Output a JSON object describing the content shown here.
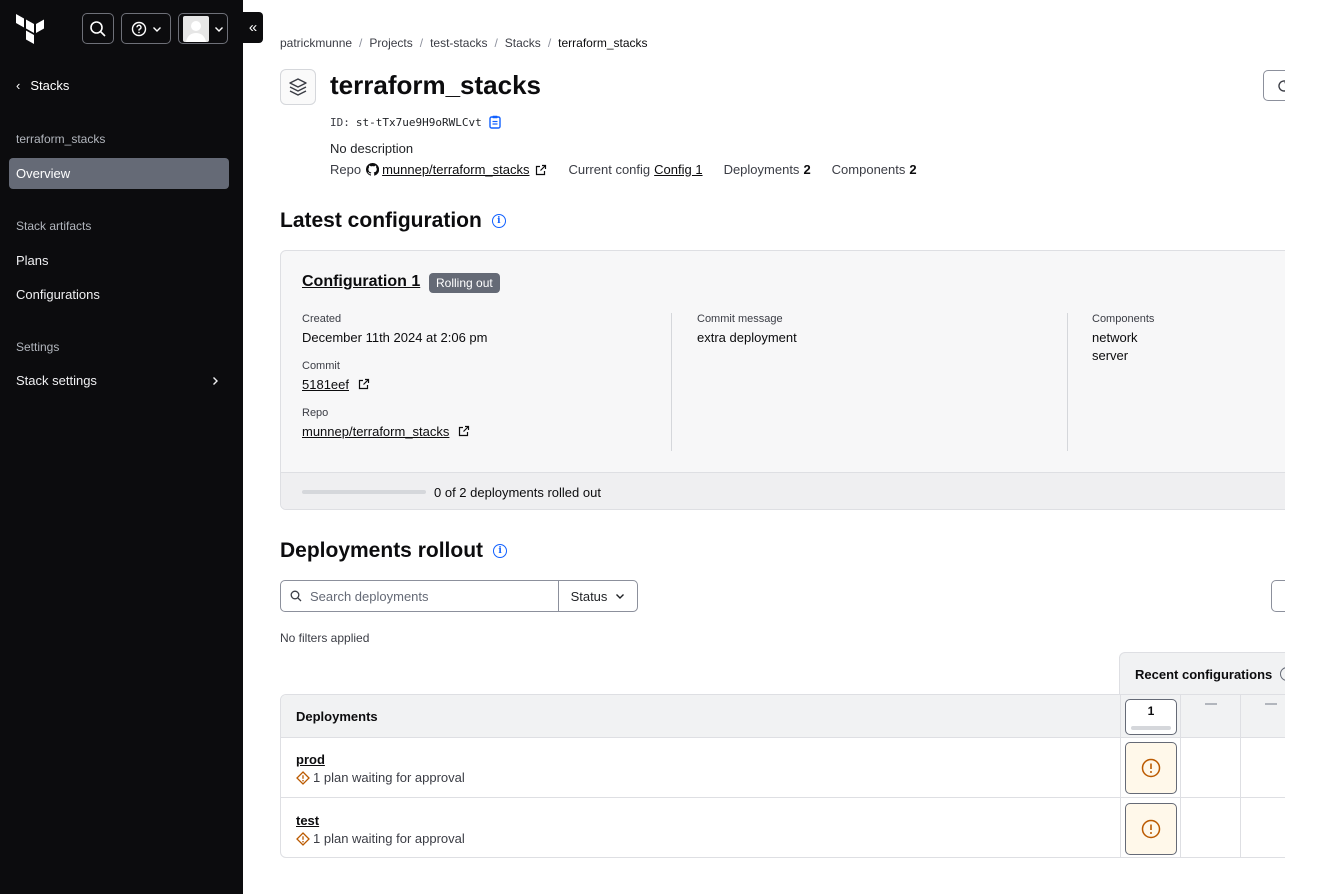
{
  "sidebar": {
    "back_label": "Stacks",
    "stack_heading": "terraform_stacks",
    "overview": "Overview",
    "artifacts_heading": "Stack artifacts",
    "plans": "Plans",
    "configurations": "Configurations",
    "settings_heading": "Settings",
    "stack_settings": "Stack settings",
    "collapse_glyph": "«"
  },
  "breadcrumb": [
    "patrickmunne",
    "Projects",
    "test-stacks",
    "Stacks",
    "terraform_stacks"
  ],
  "header": {
    "title": "terraform_stacks",
    "id_label": "ID:",
    "id_value": "st-tTx7ue9H9oRWLCvt",
    "description": "No description",
    "repo_label": "Repo",
    "repo_value": "munnep/terraform_stacks",
    "current_config_label": "Current config",
    "current_config_value": "Config 1",
    "deployments_label": "Deployments",
    "deployments_count": "2",
    "components_label": "Components",
    "components_count": "2"
  },
  "latest_config": {
    "section_title": "Latest configuration",
    "title": "Configuration 1",
    "badge": "Rolling out",
    "created_label": "Created",
    "created_value": "December 11th 2024 at 2:06 pm",
    "commit_label": "Commit",
    "commit_value": "5181eef",
    "repo_label": "Repo",
    "repo_value": "munnep/terraform_stacks",
    "message_label": "Commit message",
    "message_value": "extra deployment",
    "components_label": "Components",
    "components": [
      "network",
      "server"
    ],
    "progress_text": "0 of 2 deployments rolled out",
    "progress_fraction": 0
  },
  "deployments": {
    "section_title": "Deployments rollout",
    "search_placeholder": "Search deployments",
    "status_label": "Status",
    "no_filters": "No filters applied",
    "recent_header": "Recent configurations",
    "column_header": "Deployments",
    "config_number": "1",
    "rows": [
      {
        "name": "prod",
        "status": "1 plan waiting for approval"
      },
      {
        "name": "test",
        "status": "1 plan waiting for approval"
      }
    ]
  },
  "colors": {
    "sidebar_bg": "#0c0c0e",
    "accent_blue": "#1060ff",
    "warning_orange": "#bb5a00",
    "badge_gray": "#656a76"
  }
}
